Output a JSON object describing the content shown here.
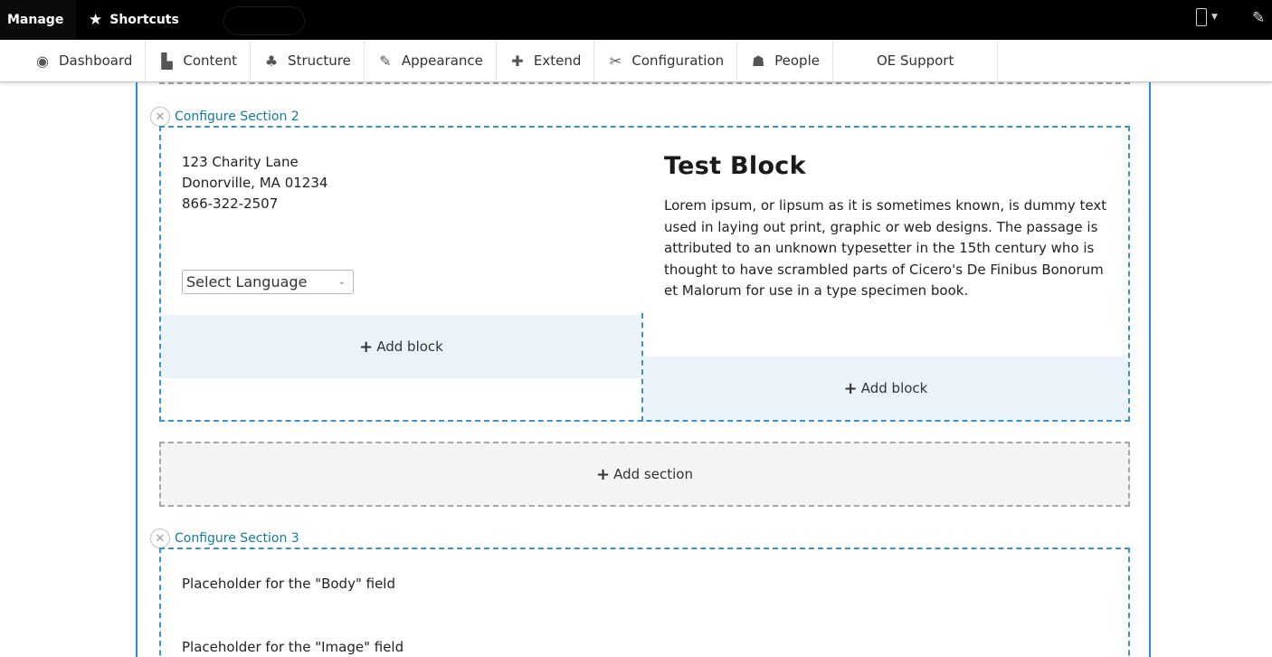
{
  "toolbar": {
    "manage_label": "Manage",
    "shortcuts_label": "Shortcuts",
    "shortcuts_icon": "star-icon",
    "device_icon": "phone-icon",
    "edit_icon": "pencil-icon"
  },
  "admin_menu": {
    "items": [
      {
        "label": "Dashboard",
        "icon": "dashboard-icon",
        "glyph": "◉"
      },
      {
        "label": "Content",
        "icon": "content-icon",
        "glyph": "▙"
      },
      {
        "label": "Structure",
        "icon": "structure-icon",
        "glyph": "♣"
      },
      {
        "label": "Appearance",
        "icon": "appearance-icon",
        "glyph": "✎"
      },
      {
        "label": "Extend",
        "icon": "extend-icon",
        "glyph": "✚"
      },
      {
        "label": "Configuration",
        "icon": "configuration-icon",
        "glyph": "✂"
      },
      {
        "label": "People",
        "icon": "people-icon",
        "glyph": "☗"
      },
      {
        "label": "OE Support"
      }
    ]
  },
  "layout": {
    "section2": {
      "configure_label": "Configure Section 2",
      "address": {
        "line1": "123 Charity Lane",
        "line2": "Donorville, MA 01234",
        "line3": "866-322-2507"
      },
      "language_select": {
        "value": "Select Language"
      },
      "first_add_block_label": "Add block",
      "test_block": {
        "title": "Test Block",
        "body": "Lorem ipsum, or lipsum as it is sometimes known, is dummy text used in laying out print, graphic or web designs. The passage is attributed to an unknown typesetter in the 15th century who is thought to have scrambled parts of Cicero's De Finibus Bonorum et Malorum for use in a type specimen book."
      },
      "second_add_block_label": "Add block"
    },
    "add_section_label": "Add section",
    "section3": {
      "configure_label": "Configure Section 3",
      "body_placeholder": "Placeholder for the \"Body\" field",
      "image_placeholder": "Placeholder for the \"Image\" field"
    }
  },
  "colors": {
    "link": "#0f7d9e",
    "region_border": "#3a91d0",
    "add_block_bg": "#ecf4fb",
    "add_section_bg": "#f4f4f4"
  }
}
